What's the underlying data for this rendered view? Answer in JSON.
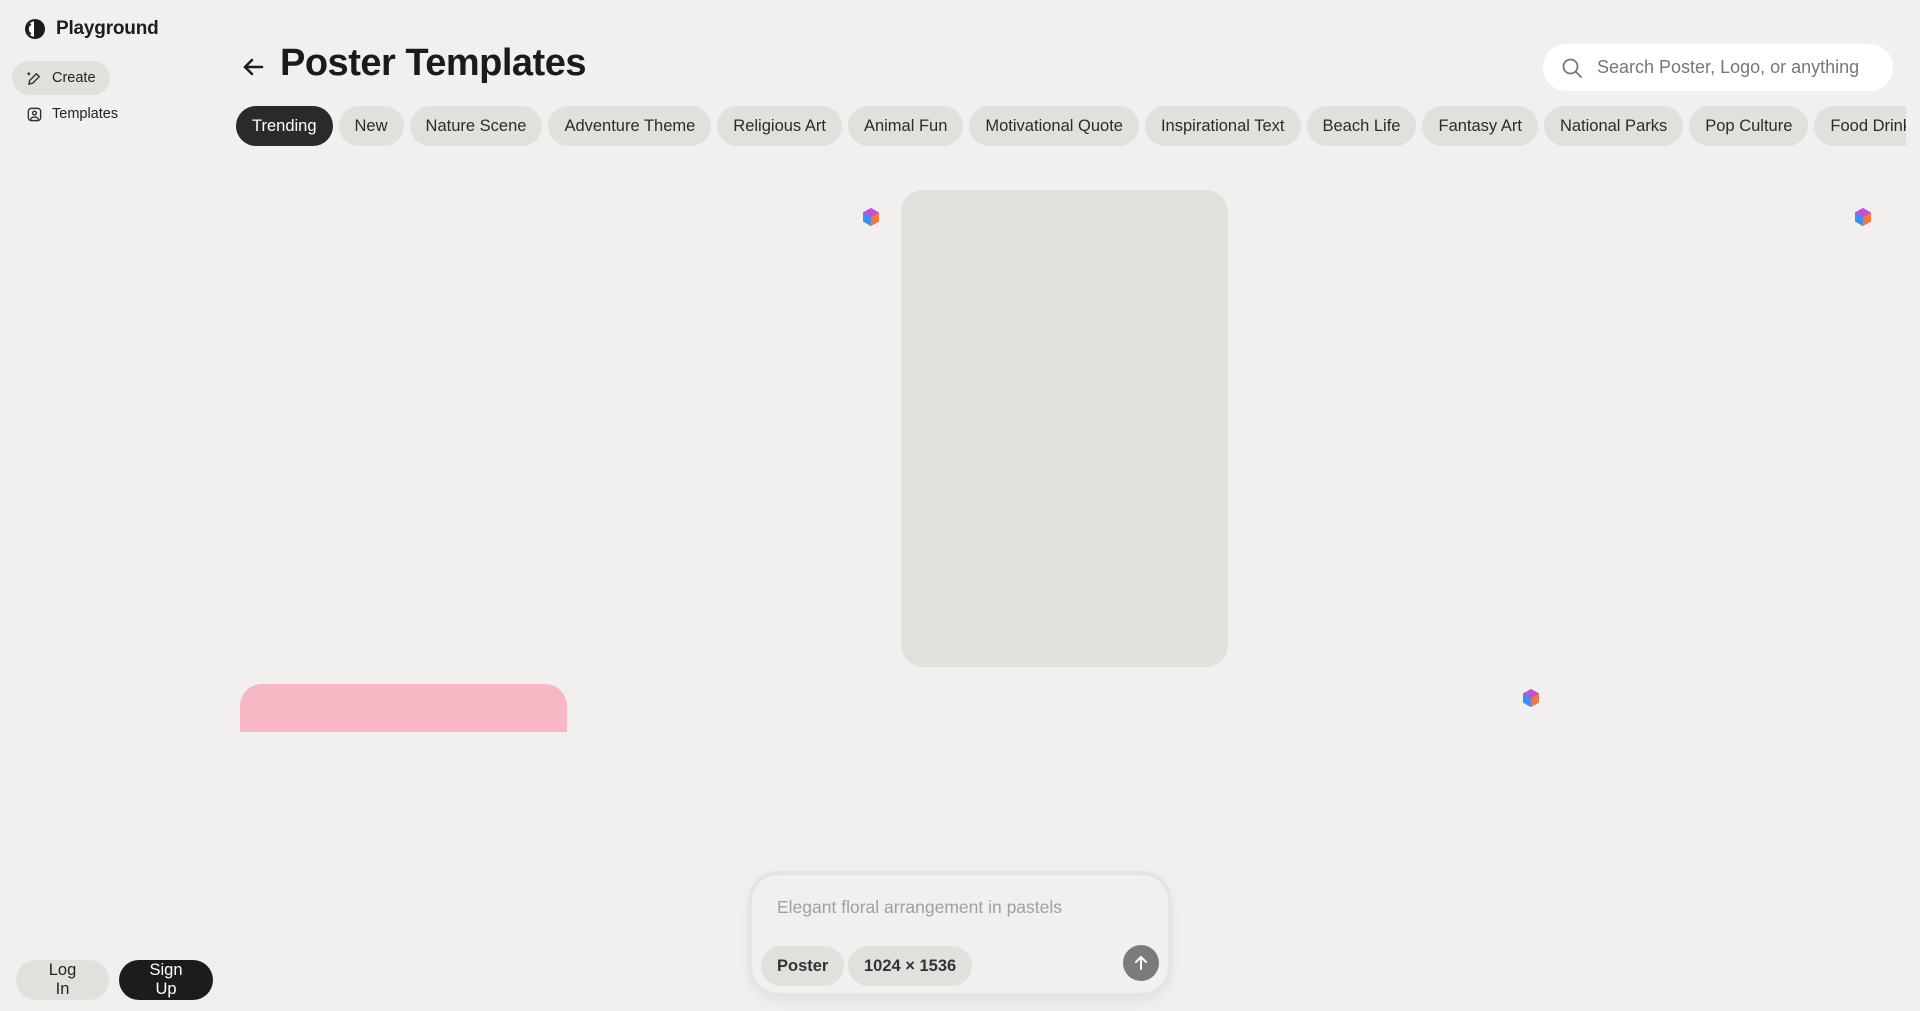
{
  "app": {
    "brand": "Playground"
  },
  "sidebar": {
    "items": [
      {
        "label": "Create",
        "icon": "pen-sparkle-icon",
        "active": true
      },
      {
        "label": "Templates",
        "icon": "image-frame-icon",
        "active": false
      }
    ],
    "login_label": "Log In",
    "signup_label": "Sign Up"
  },
  "header": {
    "title": "Poster Templates",
    "search_placeholder": "Search Poster, Logo, or anything"
  },
  "categories": [
    {
      "label": "Trending",
      "active": true
    },
    {
      "label": "New"
    },
    {
      "label": "Nature Scene"
    },
    {
      "label": "Adventure Theme"
    },
    {
      "label": "Religious Art"
    },
    {
      "label": "Animal Fun"
    },
    {
      "label": "Motivational Quote"
    },
    {
      "label": "Inspirational Text"
    },
    {
      "label": "Beach Life"
    },
    {
      "label": "Fantasy Art"
    },
    {
      "label": "National Parks"
    },
    {
      "label": "Pop Culture"
    },
    {
      "label": "Food Drink"
    }
  ],
  "composer": {
    "placeholder": "Elegant floral arrangement in pastels",
    "type_label": "Poster",
    "size_label": "1024 × 1536"
  },
  "colors": {
    "background": "#f1f0ee",
    "chip": "#e1e0dd",
    "chip_active": "#2a2a2a",
    "pink_card": "#f7b7c5"
  }
}
